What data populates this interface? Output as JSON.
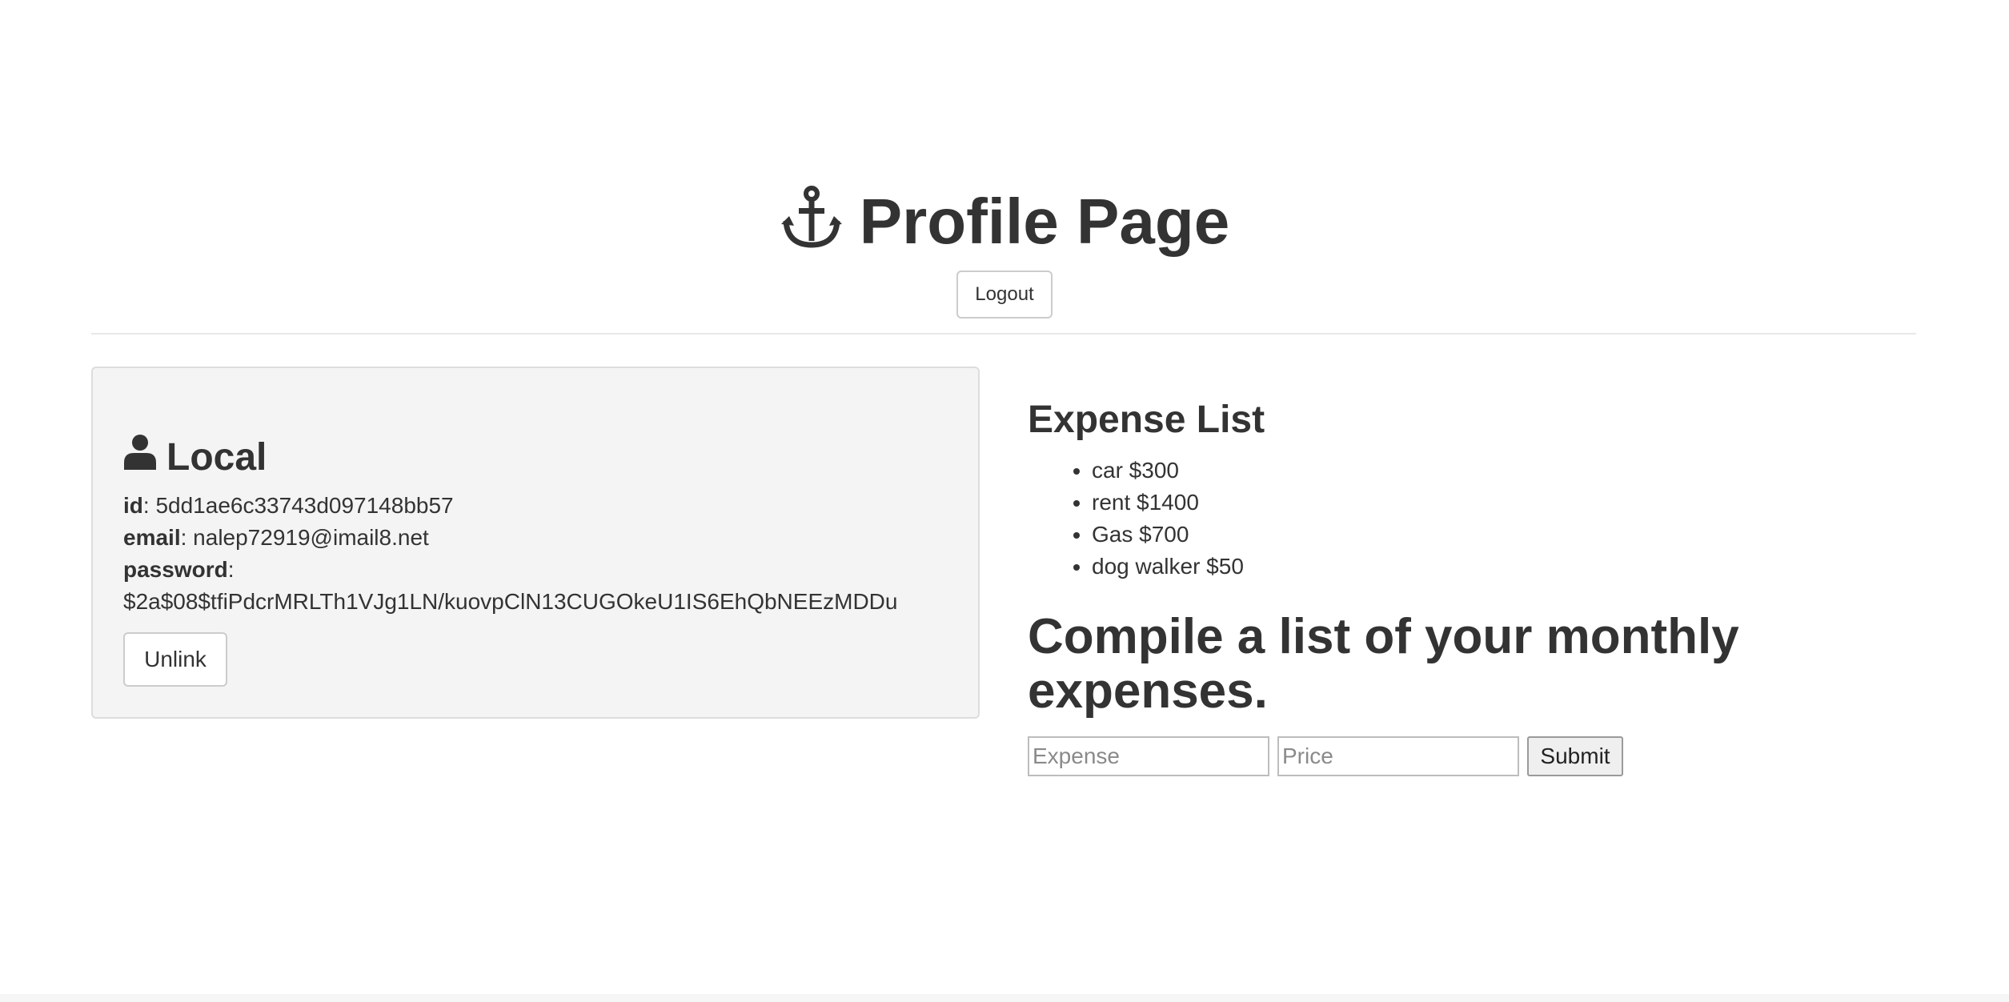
{
  "header": {
    "icon": "anchor-icon",
    "title": "Profile Page",
    "logout_label": "Logout"
  },
  "local": {
    "icon": "user-icon",
    "title": "Local",
    "id_label": "id",
    "id_value": "5dd1ae6c33743d097148bb57",
    "email_label": "email",
    "email_value": "nalep72919@imail8.net",
    "password_label": "password",
    "password_value": "$2a$08$tfiPdcrMRLTh1VJg1LN/kuovpClN13CUGOkeU1IS6EhQbNEEzMDDu",
    "unlink_label": "Unlink"
  },
  "expenses": {
    "title": "Expense List",
    "items": [
      "car $300",
      "rent $1400",
      "Gas $700",
      "dog walker $50"
    ]
  },
  "form": {
    "heading": "Compile a list of your monthly expenses.",
    "expense_placeholder": "Expense",
    "price_placeholder": "Price",
    "submit_label": "Submit"
  },
  "colors": {
    "text": "#333333",
    "panel_bg": "#f4f4f4",
    "border": "#dddddd"
  }
}
